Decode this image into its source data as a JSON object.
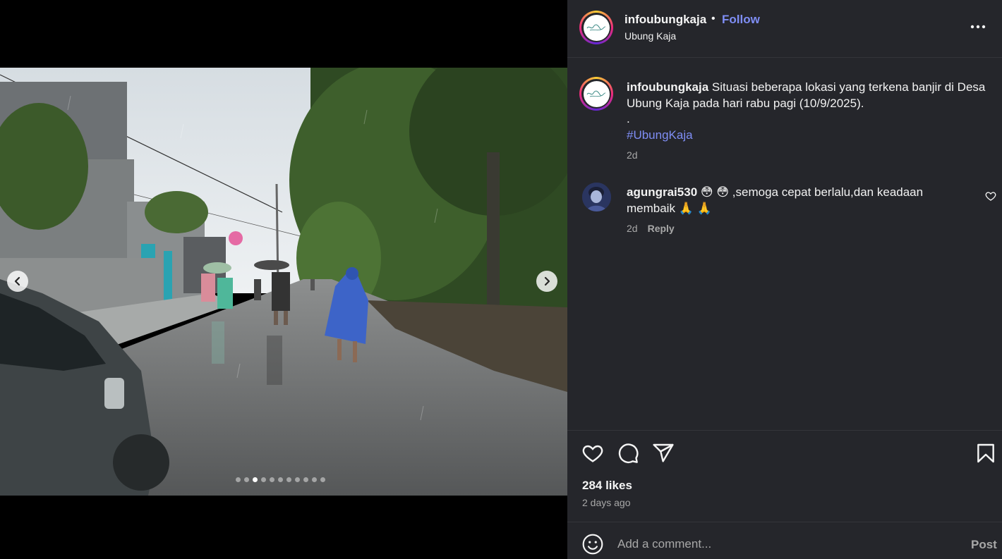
{
  "header": {
    "username": "infoubungkaja",
    "separator": "•",
    "follow_label": "Follow",
    "location": "Ubung Kaja",
    "avatar_icon": "infoubungkaja-logo",
    "more_icon": "more-horizontal-icon"
  },
  "media": {
    "description": "Photo carousel",
    "slide_count": 11,
    "active_slide": 3,
    "prev_icon": "chevron-left-icon",
    "next_icon": "chevron-right-icon"
  },
  "caption": {
    "username": "infoubungkaja",
    "text": "Situasi beberapa lokasi yang terkena banjir di Desa Ubung Kaja pada hari rabu pagi (10/9/2025).",
    "separator_line": ".",
    "hashtag": "#UbungKaja",
    "time": "2d"
  },
  "comments": [
    {
      "username": "agungrai530",
      "text": "😳 😳 ,semoga cepat berlalu,dan keadaan membaik 🙏 🙏",
      "time": "2d",
      "reply_label": "Reply"
    }
  ],
  "actions": {
    "likes": "284 likes",
    "ago": "2 days ago"
  },
  "comment_box": {
    "placeholder": "Add a comment...",
    "post_label": "Post"
  },
  "colors": {
    "panel_bg": "#25262b",
    "link_blue": "#7f8ef5",
    "muted_text": "#a8a8a8"
  }
}
